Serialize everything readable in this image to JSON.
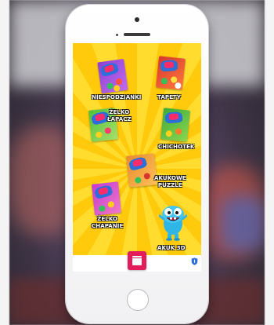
{
  "app": {
    "items": [
      {
        "id": "niespodzianki",
        "label": "NIESPODZIANKI"
      },
      {
        "id": "tapety",
        "label": "TAPETY"
      },
      {
        "id": "zelko-lapacz",
        "label": "ŻELKO\nŁAPACZ"
      },
      {
        "id": "chichotek",
        "label": "CHICHOTEK"
      },
      {
        "id": "akukowe-puzzle",
        "label": "AKUKOWE\nPUZZLE"
      },
      {
        "id": "zelko-chapanie",
        "label": "ŻELKO\nCHAPANIE"
      },
      {
        "id": "akuk-3d",
        "label": "AKUK 3D"
      }
    ],
    "colors": {
      "background_yellow": "#ffd11a",
      "menu_button": "#e21d5b",
      "shield_icon": "#2c6fd9"
    },
    "icons": {
      "menu": "menu-square-icon",
      "privacy": "shield-icon"
    }
  }
}
